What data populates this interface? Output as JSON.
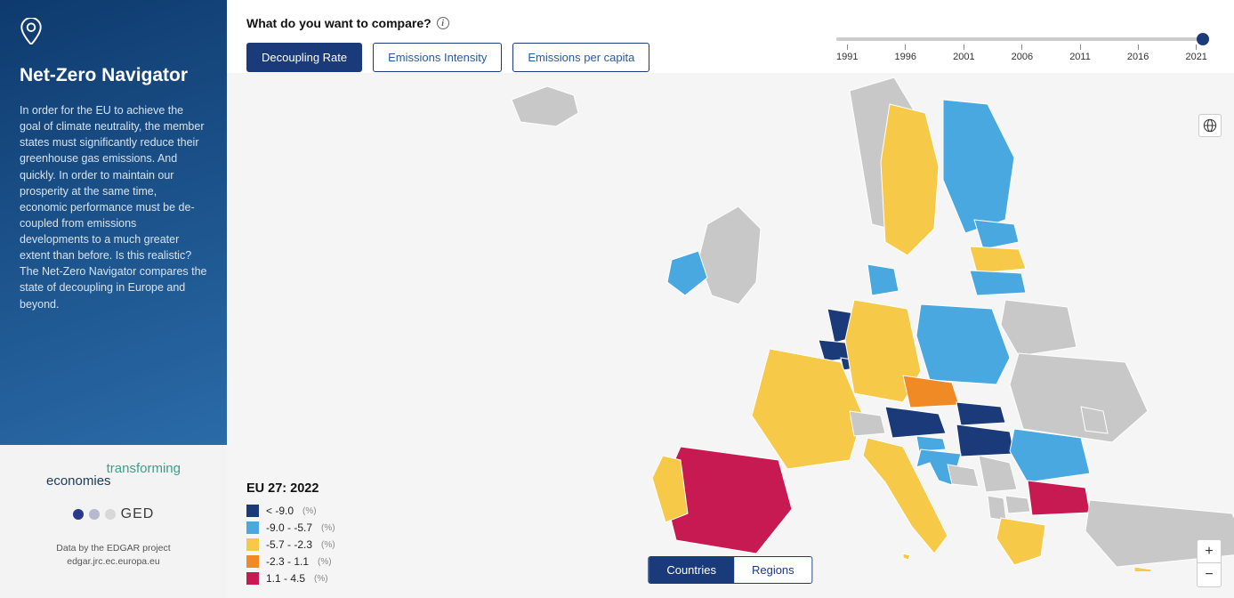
{
  "sidebar": {
    "title": "Net-Zero Navigator",
    "description": "In order for the EU to achieve the goal of climate neutrality, the member states must significantly reduce their green­house gas emissions. And quickly. In order to maintain our prosperity at the same time, economic performance must be de­coupled from emissions developments to a much greater extent than before. Is this realistic? The Net-Zero Navigator com­pares the state of decoupling in Europe and beyond.",
    "logo1_top": "transforming",
    "logo1_bottom": "economies",
    "logo2_text": "GED",
    "credit_line1": "Data by the EDGAR project",
    "credit_line2": "edgar.jrc.ec.europa.eu"
  },
  "compare": {
    "label": "What do you want to compare?",
    "options": [
      "Decoupling Rate",
      "Emissions Intensity",
      "Emissions per capita"
    ],
    "active_index": 0
  },
  "timeline": {
    "min": 1991,
    "max": 2022,
    "value": 2022,
    "ticks": [
      "1991",
      "1996",
      "2001",
      "2006",
      "2011",
      "2016",
      "2021"
    ]
  },
  "legend": {
    "title": "EU 27: 2022",
    "unit": "(%)",
    "items": [
      {
        "color": "#1a3a7a",
        "label": "< -9.0"
      },
      {
        "color": "#4aa8e0",
        "label": "-9.0 - -5.7"
      },
      {
        "color": "#f7c948",
        "label": "-5.7 - -2.3"
      },
      {
        "color": "#f08a24",
        "label": "-2.3 - 1.1"
      },
      {
        "color": "#c81a52",
        "label": "1.1 - 4.5"
      }
    ]
  },
  "view_toggle": {
    "options": [
      "Countries",
      "Regions"
    ],
    "active_index": 0
  },
  "help_label": "?",
  "zoom": {
    "in": "+",
    "out": "−"
  },
  "colors": {
    "darkblue": "#1a3a7a",
    "lightblue": "#4aa8e0",
    "yellow": "#f7c948",
    "orange": "#f08a24",
    "magenta": "#c81a52",
    "gray": "#c8c8c8"
  },
  "map_countries": {
    "Spain": "magenta",
    "Portugal": "yellow",
    "France": "yellow",
    "Italy": "yellow",
    "Germany": "yellow",
    "Poland": "lightblue",
    "Sweden": "yellow",
    "Finland": "lightblue",
    "Norway": "gray",
    "UK": "gray",
    "Ireland": "lightblue",
    "Netherlands": "darkblue",
    "Belgium": "darkblue",
    "Denmark": "lightblue",
    "Czechia": "orange",
    "Austria": "darkblue",
    "Hungary": "darkblue",
    "Slovakia": "darkblue",
    "Slovenia": "lightblue",
    "Croatia": "lightblue",
    "Romania": "lightblue",
    "Bulgaria": "magenta",
    "Greece": "yellow",
    "Estonia": "lightblue",
    "Latvia": "yellow",
    "Lithuania": "lightblue",
    "Luxembourg": "darkblue",
    "Switzerland": "gray",
    "Ukraine": "gray",
    "Belarus": "gray",
    "Turkey": "gray",
    "Serbia": "gray",
    "Bosnia": "gray",
    "Albania": "gray",
    "NorthMacedonia": "gray",
    "Moldova": "gray",
    "Cyprus": "yellow",
    "Malta": "yellow",
    "Iceland": "gray"
  }
}
